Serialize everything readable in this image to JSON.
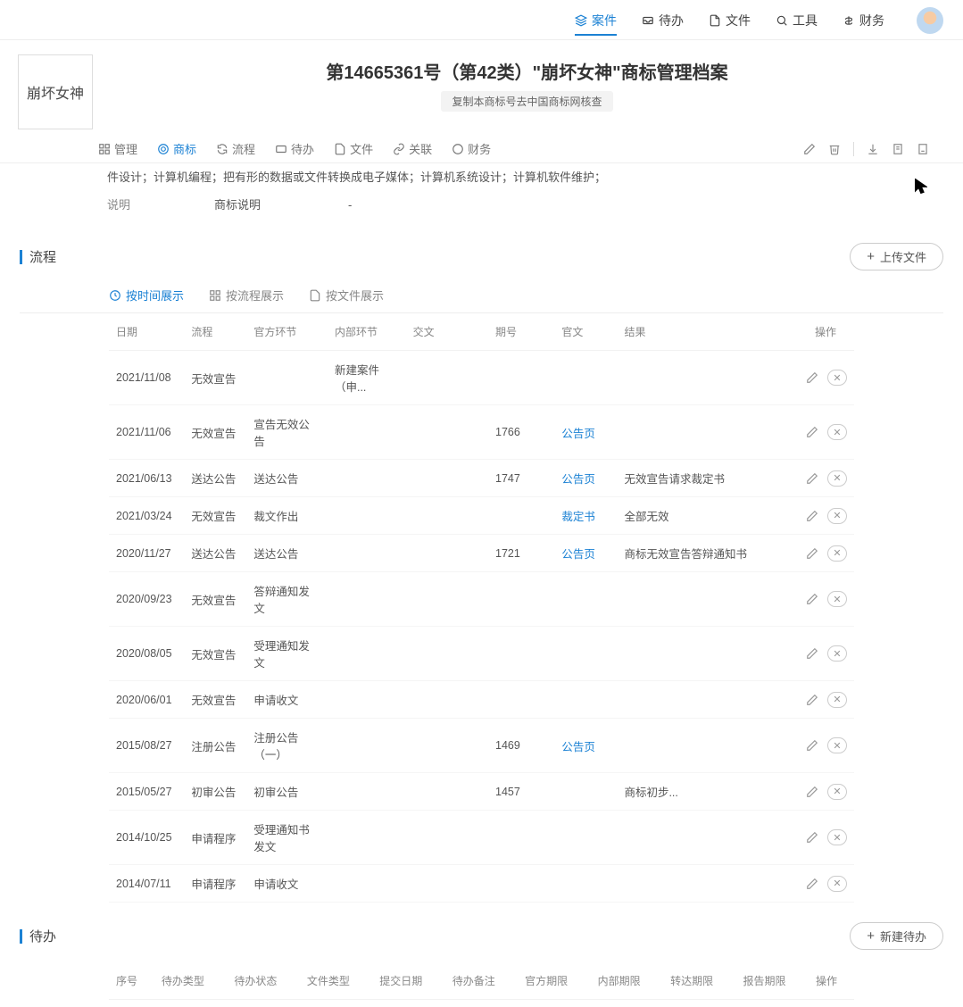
{
  "topnav": {
    "items": [
      {
        "icon": "layers",
        "label": "案件",
        "active": true
      },
      {
        "icon": "inbox",
        "label": "待办"
      },
      {
        "icon": "file",
        "label": "文件"
      },
      {
        "icon": "search",
        "label": "工具"
      },
      {
        "icon": "money",
        "label": "财务"
      }
    ]
  },
  "logo_text": "崩坏女神",
  "header": {
    "title": "第14665361号（第42类）\"崩坏女神\"商标管理档案",
    "sub": "复制本商标号去中国商标网核查"
  },
  "subnav": {
    "tabs": [
      {
        "icon": "dash",
        "label": "管理"
      },
      {
        "icon": "target",
        "label": "商标",
        "active": true
      },
      {
        "icon": "refresh",
        "label": "流程"
      },
      {
        "icon": "inbox",
        "label": "待办"
      },
      {
        "icon": "file",
        "label": "文件"
      },
      {
        "icon": "link",
        "label": "关联"
      },
      {
        "icon": "target",
        "label": "财务"
      }
    ]
  },
  "desc": {
    "line1": "件设计；计算机编程；把有形的数据或文件转换成电子媒体；计算机系统设计；计算机软件维护；",
    "label": "说明",
    "v1": "商标说明",
    "v2": "-"
  },
  "flow": {
    "title": "流程",
    "upload_btn": "上传文件",
    "view_tabs": [
      {
        "icon": "clock",
        "label": "按时间展示",
        "active": true
      },
      {
        "icon": "grid",
        "label": "按流程展示"
      },
      {
        "icon": "doc",
        "label": "按文件展示"
      }
    ],
    "columns": [
      "日期",
      "流程",
      "官方环节",
      "内部环节",
      "交文",
      "期号",
      "官文",
      "结果",
      "操作"
    ],
    "rows": [
      {
        "date": "2021/11/08",
        "proc": "无效宣告",
        "off": "",
        "int": "新建案件（申...",
        "jw": "",
        "iss": "",
        "gw": "",
        "res": ""
      },
      {
        "date": "2021/11/06",
        "proc": "无效宣告",
        "off": "宣告无效公告",
        "int": "",
        "jw": "",
        "iss": "1766",
        "gw": "公告页",
        "res": ""
      },
      {
        "date": "2021/06/13",
        "proc": "送达公告",
        "off": "送达公告",
        "int": "",
        "jw": "",
        "iss": "1747",
        "gw": "公告页",
        "res": "无效宣告请求裁定书"
      },
      {
        "date": "2021/03/24",
        "proc": "无效宣告",
        "off": "裁文作出",
        "int": "",
        "jw": "",
        "iss": "",
        "gw": "裁定书",
        "res": "全部无效"
      },
      {
        "date": "2020/11/27",
        "proc": "送达公告",
        "off": "送达公告",
        "int": "",
        "jw": "",
        "iss": "1721",
        "gw": "公告页",
        "res": "商标无效宣告答辩通知书"
      },
      {
        "date": "2020/09/23",
        "proc": "无效宣告",
        "off": "答辩通知发文",
        "int": "",
        "jw": "",
        "iss": "",
        "gw": "",
        "res": ""
      },
      {
        "date": "2020/08/05",
        "proc": "无效宣告",
        "off": "受理通知发文",
        "int": "",
        "jw": "",
        "iss": "",
        "gw": "",
        "res": ""
      },
      {
        "date": "2020/06/01",
        "proc": "无效宣告",
        "off": "申请收文",
        "int": "",
        "jw": "",
        "iss": "",
        "gw": "",
        "res": ""
      },
      {
        "date": "2015/08/27",
        "proc": "注册公告",
        "off": "注册公告（一）",
        "int": "",
        "jw": "",
        "iss": "1469",
        "gw": "公告页",
        "res": ""
      },
      {
        "date": "2015/05/27",
        "proc": "初审公告",
        "off": "初审公告",
        "int": "",
        "jw": "",
        "iss": "1457",
        "gw": "",
        "res": "商标初步..."
      },
      {
        "date": "2014/10/25",
        "proc": "申请程序",
        "off": "受理通知书发文",
        "int": "",
        "jw": "",
        "iss": "",
        "gw": "",
        "res": ""
      },
      {
        "date": "2014/07/11",
        "proc": "申请程序",
        "off": "申请收文",
        "int": "",
        "jw": "",
        "iss": "",
        "gw": "",
        "res": ""
      }
    ]
  },
  "todo": {
    "title": "待办",
    "new_btn": "新建待办",
    "columns": [
      "序号",
      "待办类型",
      "待办状态",
      "文件类型",
      "提交日期",
      "待办备注",
      "官方期限",
      "内部期限",
      "转达期限",
      "报告期限",
      "操作"
    ]
  }
}
